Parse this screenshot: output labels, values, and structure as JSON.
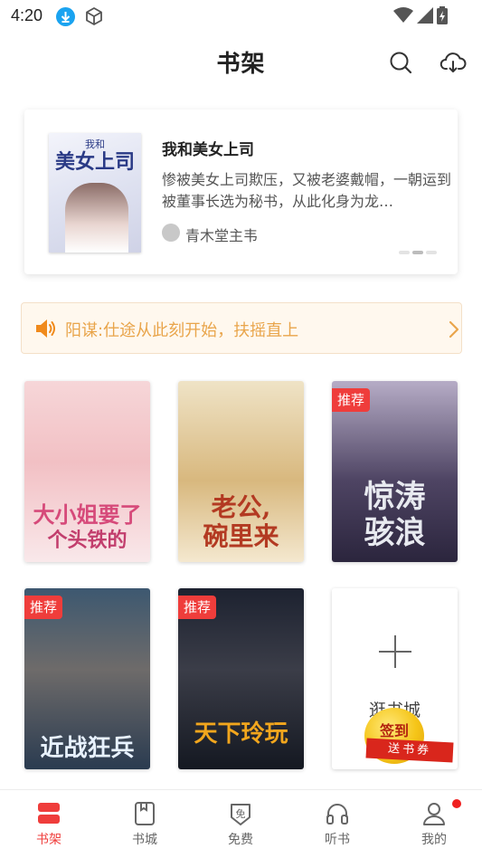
{
  "status_bar": {
    "time": "4:20"
  },
  "header": {
    "title": "书架"
  },
  "featured": {
    "book_title": "我和美女上司",
    "description": "惨被美女上司欺压，又被老婆戴帽，一朝运到被董事长选为秘书，从此化身为龙…",
    "author": "青木堂主韦",
    "cover_title": "美女上司",
    "cover_title_prefix": "我和"
  },
  "notice": {
    "text": "阳谋:仕途从此刻开始，扶摇直上"
  },
  "books": [
    {
      "cover_text_1": "大小姐要了",
      "cover_text_2": "个头铁的",
      "badge": ""
    },
    {
      "cover_text_1": "老公,",
      "cover_text_2": "碗里来",
      "badge": ""
    },
    {
      "cover_text_1": "惊涛",
      "cover_text_2": "骇浪",
      "badge": "推荐"
    },
    {
      "cover_text_1": "近战狂兵",
      "cover_text_2": "",
      "badge": "推荐"
    },
    {
      "cover_text_1": "天下玲玩",
      "cover_text_2": "",
      "badge": "推荐"
    }
  ],
  "add_book": {
    "label": "逛书城",
    "signin": "签到",
    "signin_sub": "送书券"
  },
  "nav": {
    "tabs": [
      {
        "label": "书架",
        "icon": "bookshelf-icon",
        "active": true
      },
      {
        "label": "书城",
        "icon": "bookstore-icon",
        "active": false
      },
      {
        "label": "免费",
        "icon": "free-icon",
        "active": false
      },
      {
        "label": "听书",
        "icon": "headphones-icon",
        "active": false
      },
      {
        "label": "我的",
        "icon": "profile-icon",
        "active": false
      }
    ]
  },
  "colors": {
    "accent": "#ef3d3b",
    "notice_text": "#e9a54b",
    "notice_bg": "#fff8ee"
  }
}
